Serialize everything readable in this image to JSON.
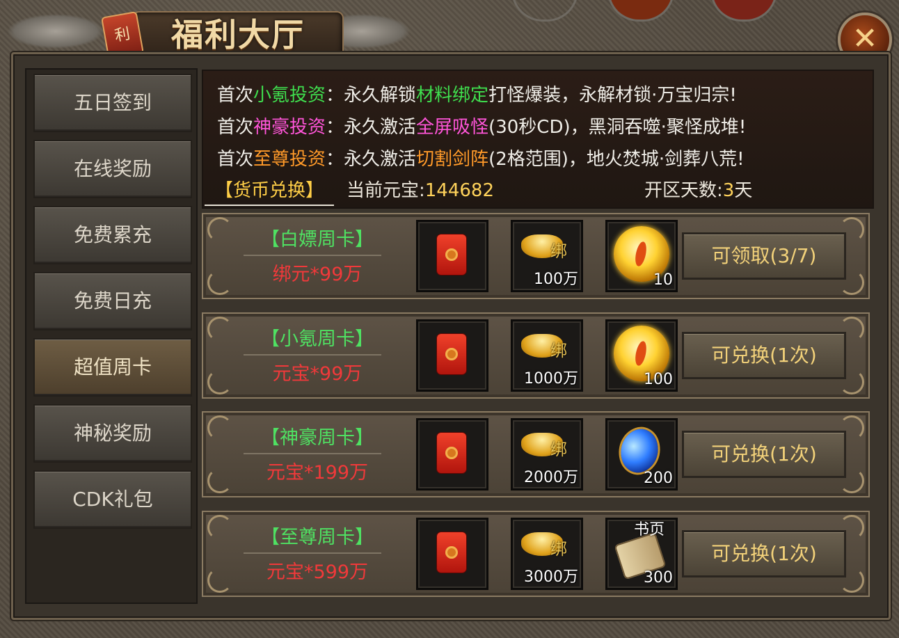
{
  "header": {
    "title": "福利大厅",
    "seal_char": "利",
    "close_symbol": "✕"
  },
  "sidebar": {
    "items": [
      {
        "label": "五日签到",
        "active": false
      },
      {
        "label": "在线奖励",
        "active": false
      },
      {
        "label": "免费累充",
        "active": false
      },
      {
        "label": "免费日充",
        "active": false
      },
      {
        "label": "超值周卡",
        "active": true
      },
      {
        "label": "神秘奖励",
        "active": false
      },
      {
        "label": "CDK礼包",
        "active": false
      }
    ]
  },
  "info": {
    "lines": [
      {
        "p1": "首次",
        "h1": "小氪投资",
        "p2": "：永久解锁",
        "h2": "材料绑定",
        "p3": "打怪爆装，永解材锁·万宝归宗!",
        "c1": "green",
        "c2": "green"
      },
      {
        "p1": "首次",
        "h1": "神豪投资",
        "p2": "：永久激活",
        "h2": "全屏吸怪",
        "p3": "(30秒CD)，黑洞吞噬·聚怪成堆!",
        "c1": "pink",
        "c2": "pink"
      },
      {
        "p1": "首次",
        "h1": "至尊投资",
        "p2": "：永久激活",
        "h2": "切割剑阵",
        "p3": "(2格范围)，地火焚城·剑葬八荒!",
        "c1": "orange",
        "c2": "orange"
      }
    ],
    "currency_tab": "【货币兑换】",
    "ingot_label": "当前元宝:",
    "ingot_value": "144682",
    "days_label": "开区天数:",
    "days_value": "3",
    "days_unit": "天"
  },
  "cards": [
    {
      "title": "【白嫖周卡】",
      "price": "绑元*99万",
      "item2_tag": "绑",
      "item2_qty": "100万",
      "item3_type": "orb",
      "item3_qty": "10",
      "button": "可领取(3/7)"
    },
    {
      "title": "【小氪周卡】",
      "price": "元宝*99万",
      "item2_tag": "绑",
      "item2_qty": "1000万",
      "item3_type": "orb",
      "item3_qty": "100",
      "button": "可兑换(1次)"
    },
    {
      "title": "【神豪周卡】",
      "price": "元宝*199万",
      "item2_tag": "绑",
      "item2_qty": "2000万",
      "item3_type": "blue-gem",
      "item3_qty": "200",
      "button": "可兑换(1次)"
    },
    {
      "title": "【至尊周卡】",
      "price": "元宝*599万",
      "item2_tag": "绑",
      "item2_qty": "3000万",
      "item3_type": "scroll",
      "item3_label": "书页",
      "item3_qty": "300",
      "button": "可兑换(1次)"
    }
  ],
  "colors": {
    "green": "#3fde4e",
    "pink": "#ff55d9",
    "orange": "#ff9a29",
    "price_red": "#f1393a",
    "gold_text": "#f3d27a"
  }
}
